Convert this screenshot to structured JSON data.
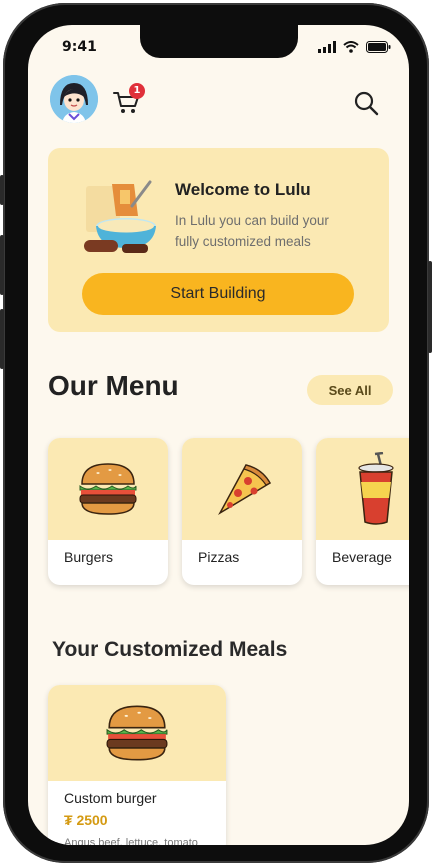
{
  "status_bar": {
    "time": "9:41"
  },
  "header": {
    "avatar_icon": "user-avatar",
    "cart_icon": "cart-icon",
    "cart_badge": "1",
    "search_icon": "search-icon"
  },
  "welcome": {
    "title": "Welcome to Lulu",
    "subtitle": "In Lulu you can build your fully customized meals",
    "button_label": "Start Building"
  },
  "menu": {
    "title": "Our Menu",
    "see_all_label": "See All",
    "items": [
      {
        "label": "Burgers",
        "icon": "burger-icon"
      },
      {
        "label": "Pizzas",
        "icon": "pizza-slice-icon"
      },
      {
        "label": "Beverage",
        "icon": "soda-cup-icon"
      }
    ]
  },
  "customized": {
    "title": "Your Customized Meals",
    "meals": [
      {
        "name": "Custom burger",
        "price": "₮ 2500",
        "description": "Angus beef, lettuce, tomato"
      }
    ]
  },
  "colors": {
    "accent": "#f9b51f",
    "card_bg": "#fbe9b3",
    "screen_bg": "#fdf8ee",
    "badge": "#e0303a",
    "price": "#d49a12"
  }
}
